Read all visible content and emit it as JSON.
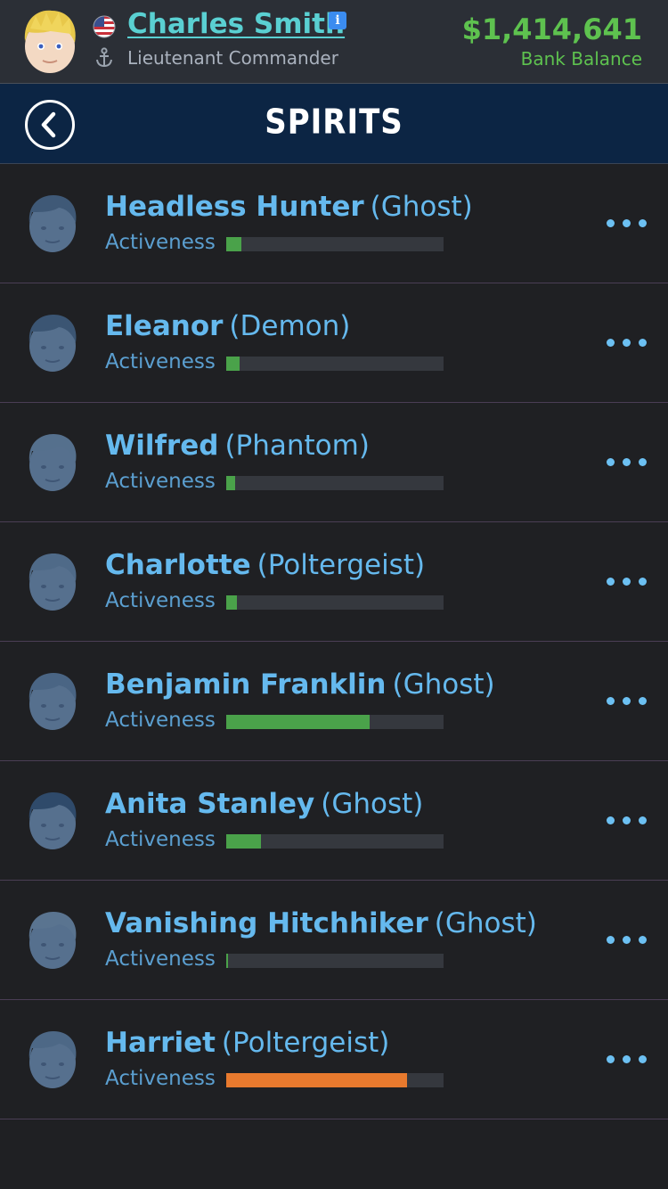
{
  "header": {
    "player_name": "Charles Smith",
    "player_rank": "Lieutenant Commander",
    "balance": "$1,414,641",
    "balance_label": "Bank Balance",
    "icons": [
      "avatar",
      "us-flag-icon",
      "anchor-icon",
      "info-icon"
    ]
  },
  "titlebar": {
    "title": "SPIRITS",
    "back_icon": "chevron-left-icon"
  },
  "colors": {
    "name": "#65b9ee",
    "activeness_green": "#4aa24a",
    "activeness_orange": "#e87a2e",
    "balance": "#5ec24f",
    "player_name": "#5ad0d2"
  },
  "spirits": [
    {
      "name": "Headless Hunter",
      "type": "(Ghost)",
      "activeness_label": "Activeness",
      "activeness": 0.07,
      "color": "#4aa24a"
    },
    {
      "name": "Eleanor",
      "type": "(Demon)",
      "activeness_label": "Activeness",
      "activeness": 0.06,
      "color": "#4aa24a"
    },
    {
      "name": "Wilfred",
      "type": "(Phantom)",
      "activeness_label": "Activeness",
      "activeness": 0.04,
      "color": "#4aa24a"
    },
    {
      "name": "Charlotte",
      "type": "(Poltergeist)",
      "activeness_label": "Activeness",
      "activeness": 0.05,
      "color": "#4aa24a"
    },
    {
      "name": "Benjamin Franklin",
      "type": "(Ghost)",
      "activeness_label": "Activeness",
      "activeness": 0.66,
      "color": "#4aa24a"
    },
    {
      "name": "Anita Stanley",
      "type": "(Ghost)",
      "activeness_label": "Activeness",
      "activeness": 0.16,
      "color": "#4aa24a"
    },
    {
      "name": "Vanishing Hitchhiker",
      "type": "(Ghost)",
      "activeness_label": "Activeness",
      "activeness": 0.01,
      "color": "#4aa24a"
    },
    {
      "name": "Harriet",
      "type": "(Poltergeist)",
      "activeness_label": "Activeness",
      "activeness": 0.83,
      "color": "#e87a2e"
    }
  ]
}
